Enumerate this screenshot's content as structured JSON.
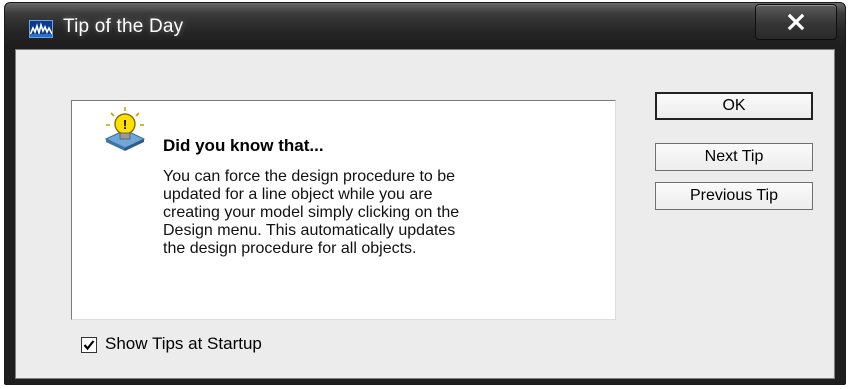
{
  "window": {
    "title": "Tip of the Day"
  },
  "tip": {
    "heading": "Did you know that...",
    "lines": [
      "You can force the design procedure to be",
      "updated for a line object while you are",
      "creating your model simply clicking on the",
      "Design menu. This automatically updates",
      "the design procedure for all objects."
    ]
  },
  "buttons": {
    "ok": "OK",
    "next_tip": "Next Tip",
    "previous_tip": "Previous Tip"
  },
  "startup_checkbox": {
    "label": "Show Tips at Startup",
    "checked": true
  },
  "icons": {
    "app": "app-icon",
    "tip": "lightbulb-icon",
    "close": "close-icon",
    "check": "checkmark-icon"
  }
}
